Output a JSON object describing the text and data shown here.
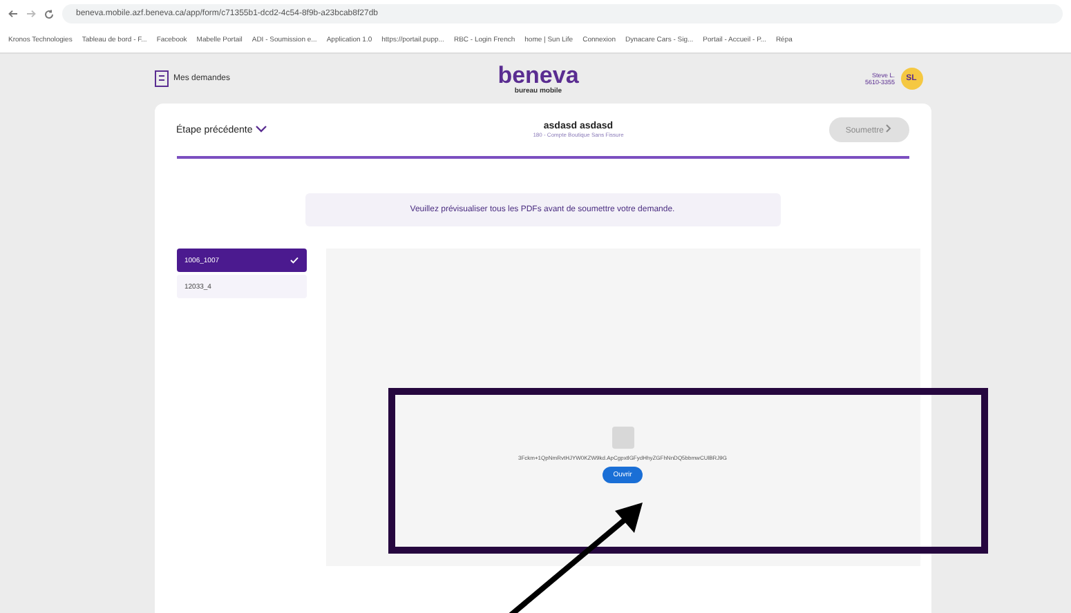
{
  "browser": {
    "url": "beneva.mobile.azf.beneva.ca/app/form/c71355b1-dcd2-4c54-8f9b-a23bcab8f27db",
    "bookmarks": [
      "Kronos Technologies",
      "Tableau de bord - F...",
      "Facebook",
      "Mabelle Portail",
      "ADI - Soumission e...",
      "Application 1.0",
      "https://portail.pupp...",
      "RBC - Login French",
      "home | Sun Life",
      "Connexion",
      "Dynacare Cars - Sig...",
      "Portail - Accueil - P...",
      "Répa"
    ]
  },
  "header": {
    "requests_link": "Mes demandes",
    "logo": "beneva",
    "logo_subtitle": "bureau mobile",
    "user_name": "Steve L.",
    "user_id": "5610-3355",
    "avatar": "SL"
  },
  "form_bar": {
    "back": "Étape précédente",
    "title": "asdasd asdasd",
    "subtitle": "180 - Compte Boutique Sans Fissure",
    "submit": {
      "label": "Soumettre",
      "disabled": true
    }
  },
  "notice": "Veuillez prévisualiser tous les PDFs avant de soumettre votre demande.",
  "documents": [
    {
      "label": "1006_1007",
      "selected": true
    },
    {
      "label": "12033_4",
      "selected": false
    }
  ],
  "viewer": {
    "file_name": "3Fckm+1QpNmRvtHJYW0KZW9kd.ApCgpxtlGFydHhyZGFhNnDQ5bbmwCUlBRJ9G",
    "open_button": "Ouvrir"
  }
}
